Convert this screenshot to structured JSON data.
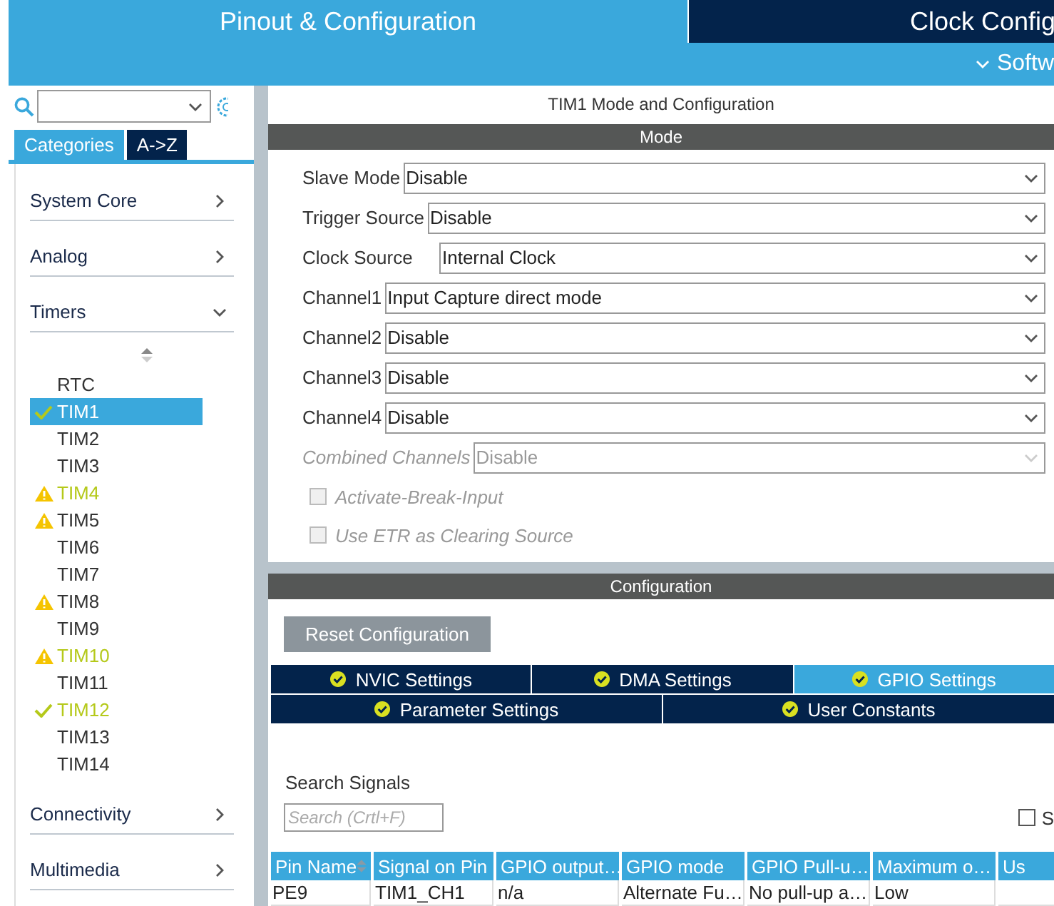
{
  "header": {
    "tabs": [
      {
        "label": "Pinout & Configuration",
        "selected": true
      },
      {
        "label": "Clock Config",
        "selected": false
      }
    ],
    "subbar": {
      "label": "Softw"
    }
  },
  "sidebar": {
    "tabs": [
      {
        "label": "Categories",
        "selected": true
      },
      {
        "label": "A->Z",
        "selected": false
      }
    ],
    "categories_top": [
      {
        "label": "System Core",
        "expanded": false
      },
      {
        "label": "Analog",
        "expanded": false
      },
      {
        "label": "Timers",
        "expanded": true
      }
    ],
    "timers": [
      {
        "label": "RTC",
        "kind": "none",
        "color": "#333333",
        "selected": false
      },
      {
        "label": "TIM1",
        "kind": "ok",
        "color": "#ffffff",
        "selected": true
      },
      {
        "label": "TIM2",
        "kind": "none",
        "color": "#333333",
        "selected": false
      },
      {
        "label": "TIM3",
        "kind": "none",
        "color": "#333333",
        "selected": false
      },
      {
        "label": "TIM4",
        "kind": "warning",
        "color": "#b5c91a",
        "selected": false
      },
      {
        "label": "TIM5",
        "kind": "warning",
        "color": "#333333",
        "selected": false
      },
      {
        "label": "TIM6",
        "kind": "none",
        "color": "#333333",
        "selected": false
      },
      {
        "label": "TIM7",
        "kind": "none",
        "color": "#333333",
        "selected": false
      },
      {
        "label": "TIM8",
        "kind": "warning",
        "color": "#333333",
        "selected": false
      },
      {
        "label": "TIM9",
        "kind": "none",
        "color": "#333333",
        "selected": false
      },
      {
        "label": "TIM10",
        "kind": "warning",
        "color": "#b5c91a",
        "selected": false
      },
      {
        "label": "TIM11",
        "kind": "none",
        "color": "#333333",
        "selected": false
      },
      {
        "label": "TIM12",
        "kind": "ok",
        "color": "#b5c91a",
        "selected": false
      },
      {
        "label": "TIM13",
        "kind": "none",
        "color": "#333333",
        "selected": false
      },
      {
        "label": "TIM14",
        "kind": "none",
        "color": "#333333",
        "selected": false
      }
    ],
    "categories_bottom": [
      {
        "label": "Connectivity",
        "expanded": false
      },
      {
        "label": "Multimedia",
        "expanded": false
      }
    ]
  },
  "panel": {
    "title": "TIM1 Mode and Configuration",
    "mode_header": "Mode",
    "fields": [
      {
        "label": "Slave Mode",
        "value": "Disable",
        "disabled": false
      },
      {
        "label": "Trigger Source",
        "value": "Disable",
        "disabled": false
      },
      {
        "label": "Clock Source",
        "value": "Internal Clock",
        "disabled": false
      },
      {
        "label": "Channel1",
        "value": "Input Capture direct mode",
        "disabled": false
      },
      {
        "label": "Channel2",
        "value": "Disable",
        "disabled": false
      },
      {
        "label": "Channel3",
        "value": "Disable",
        "disabled": false
      },
      {
        "label": "Channel4",
        "value": "Disable",
        "disabled": false
      },
      {
        "label": "Combined Channels",
        "value": "Disable",
        "disabled": true
      }
    ],
    "checkboxes": [
      {
        "label": "Activate-Break-Input",
        "checked": false,
        "disabled": true
      },
      {
        "label": "Use ETR as Clearing Source",
        "checked": false,
        "disabled": true
      }
    ],
    "config_header": "Configuration",
    "reset_button": "Reset Configuration",
    "config_tabs": [
      [
        {
          "label": "NVIC Settings",
          "selected": false
        },
        {
          "label": "DMA Settings",
          "selected": false
        },
        {
          "label": "GPIO Settings",
          "selected": true
        }
      ],
      [
        {
          "label": "Parameter Settings",
          "selected": false
        },
        {
          "label": "User Constants",
          "selected": false
        }
      ]
    ],
    "search_label": "Search Signals",
    "search": {
      "placeholder": "Search (Crtl+F)"
    },
    "show_checkbox": {
      "label": "S",
      "checked": false
    },
    "table": {
      "columns": [
        "Pin Name",
        "Signal on Pin",
        "GPIO output…",
        "GPIO mode",
        "GPIO Pull-u…",
        "Maximum o…",
        "Us"
      ],
      "rows": [
        [
          "PE9",
          "TIM1_CH1",
          "n/a",
          "Alternate Fu…",
          "No pull-up a…",
          "Low",
          ""
        ]
      ]
    }
  }
}
